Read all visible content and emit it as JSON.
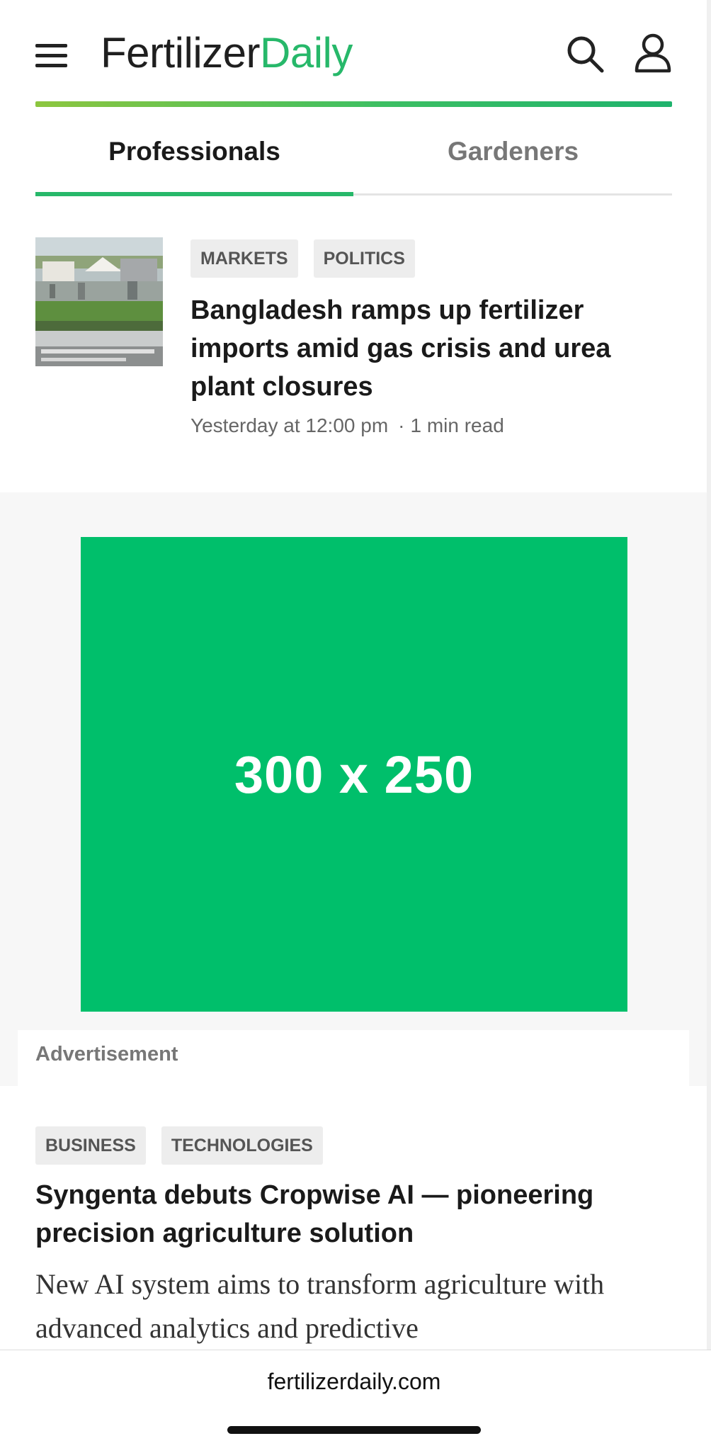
{
  "header": {
    "logo_part_1": "Fertilizer",
    "logo_part_2": "Daily",
    "brand_color": "#27b86a",
    "icons": [
      "menu-icon",
      "search-icon",
      "user-icon"
    ]
  },
  "tabs": [
    {
      "label": "Professionals",
      "active": true
    },
    {
      "label": "Gardeners",
      "active": false
    }
  ],
  "article_1": {
    "tags": [
      "MARKETS",
      "POLITICS"
    ],
    "title": "Bangladesh ramps up fertilizer imports amid gas crisis and urea plant closures",
    "time": "Yesterday at 12:00 pm",
    "separator": "·",
    "read_time": "1 min read"
  },
  "ad": {
    "size_label": "300 x 250",
    "label": "Advertisement",
    "color": "#00bf6b"
  },
  "article_2": {
    "tags": [
      "BUSINESS",
      "TECHNOLOGIES"
    ],
    "title": "Syngenta debuts Cropwise AI — pioneering precision agriculture solution",
    "excerpt": "New AI system aims to transform agriculture with advanced analytics and predictive"
  },
  "browser": {
    "url": "fertilizerdaily.com"
  }
}
